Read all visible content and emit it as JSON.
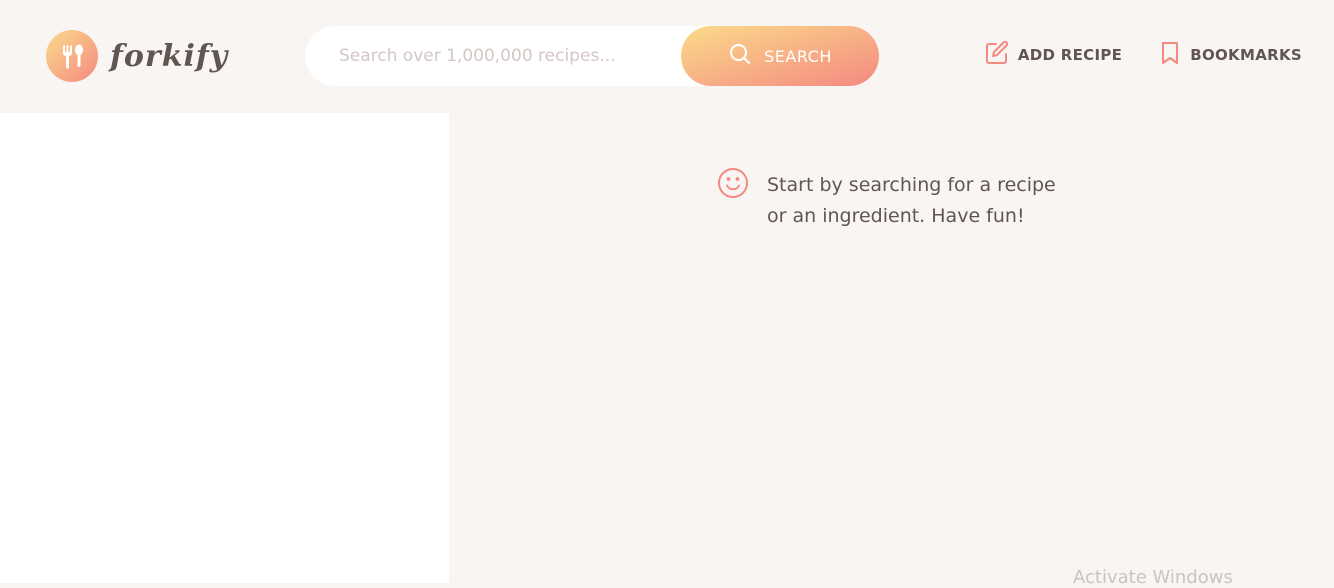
{
  "header": {
    "logo": {
      "text": "forkify",
      "icon": "fork-spoon-icon"
    },
    "search": {
      "placeholder": "Search over 1,000,000 recipes...",
      "value": "",
      "button_label": "SEARCH",
      "button_icon": "search-icon"
    },
    "nav": {
      "add_recipe": {
        "label": "ADD RECIPE",
        "icon": "edit-icon"
      },
      "bookmarks": {
        "label": "BOOKMARKS",
        "icon": "bookmark-icon"
      }
    }
  },
  "recipe": {
    "message_line1": "Start by searching for a recipe",
    "message_line2": "or an ingredient. Have fun!",
    "message_icon": "smile-icon"
  },
  "system": {
    "watermark": "Activate Windows"
  },
  "colors": {
    "accent": "#f48982",
    "gradient_start": "#fbdb89",
    "gradient_end": "#f48982",
    "text": "#615551",
    "background": "#f9f5f3"
  }
}
